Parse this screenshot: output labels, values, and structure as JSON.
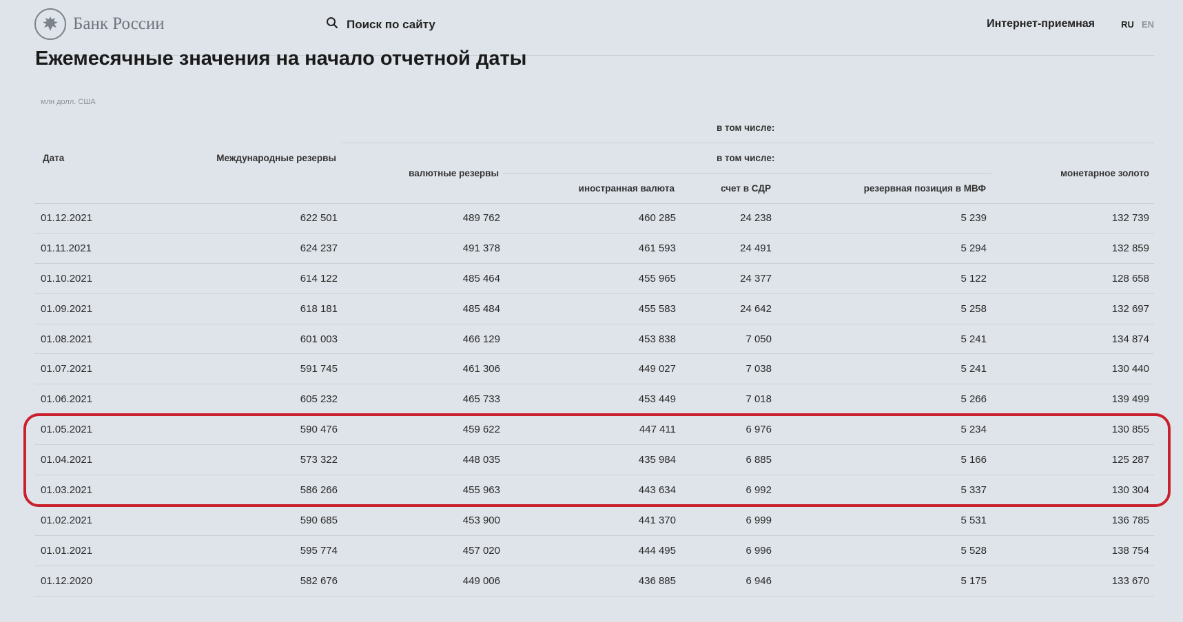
{
  "header": {
    "logo_text": "Банк России",
    "search_label": "Поиск по сайту",
    "reception_link": "Интернет-приемная",
    "lang_ru": "RU",
    "lang_en": "EN"
  },
  "page_title": "Ежемесячные значения на начало отчетной даты",
  "units": "млн долл. США",
  "table": {
    "headers": {
      "date": "Дата",
      "intl_reserves": "Международные резервы",
      "including_1": "в том числе:",
      "currency_reserves": "валютные резервы",
      "including_2": "в том числе:",
      "foreign_currency": "иностранная валюта",
      "sdr_account": "счет в СДР",
      "imf_position": "резервная позиция в МВФ",
      "monetary_gold": "монетарное золото"
    },
    "rows": [
      [
        "01.12.2021",
        "622 501",
        "489 762",
        "460 285",
        "24 238",
        "5 239",
        "132 739"
      ],
      [
        "01.11.2021",
        "624 237",
        "491 378",
        "461 593",
        "24 491",
        "5 294",
        "132 859"
      ],
      [
        "01.10.2021",
        "614 122",
        "485 464",
        "455 965",
        "24 377",
        "5 122",
        "128 658"
      ],
      [
        "01.09.2021",
        "618 181",
        "485 484",
        "455 583",
        "24 642",
        "5 258",
        "132 697"
      ],
      [
        "01.08.2021",
        "601 003",
        "466 129",
        "453 838",
        "7 050",
        "5 241",
        "134 874"
      ],
      [
        "01.07.2021",
        "591 745",
        "461 306",
        "449 027",
        "7 038",
        "5 241",
        "130 440"
      ],
      [
        "01.06.2021",
        "605 232",
        "465 733",
        "453 449",
        "7 018",
        "5 266",
        "139 499"
      ],
      [
        "01.05.2021",
        "590 476",
        "459 622",
        "447 411",
        "6 976",
        "5 234",
        "130 855"
      ],
      [
        "01.04.2021",
        "573 322",
        "448 035",
        "435 984",
        "6 885",
        "5 166",
        "125 287"
      ],
      [
        "01.03.2021",
        "586 266",
        "455 963",
        "443 634",
        "6 992",
        "5 337",
        "130 304"
      ],
      [
        "01.02.2021",
        "590 685",
        "453 900",
        "441 370",
        "6 999",
        "5 531",
        "136 785"
      ],
      [
        "01.01.2021",
        "595 774",
        "457 020",
        "444 495",
        "6 996",
        "5 528",
        "138 754"
      ],
      [
        "01.12.2020",
        "582 676",
        "449 006",
        "436 885",
        "6 946",
        "5 175",
        "133 670"
      ]
    ]
  },
  "highlight_color": "#c8202c"
}
